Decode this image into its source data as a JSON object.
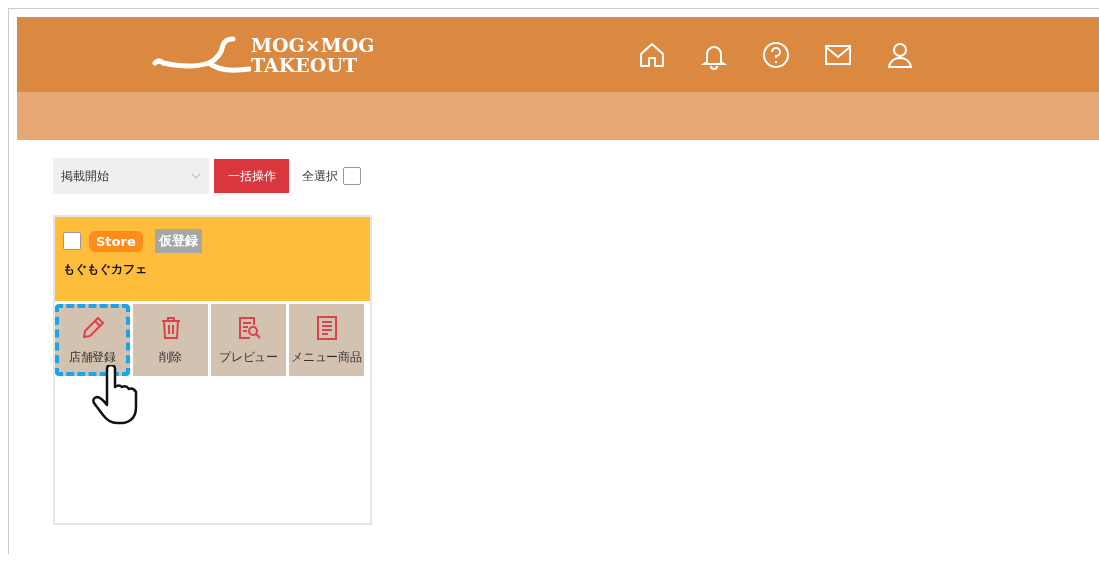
{
  "header": {
    "logo_line_1": "MOG×MOG",
    "logo_line_2": "TAKEOUT"
  },
  "toolbar": {
    "status_select": "掲載開始",
    "bulk_button": "一括操作",
    "select_all": {
      "label": "全選択",
      "checked": false
    }
  },
  "stores": [
    {
      "checked": false,
      "badge": "Store",
      "status": "仮登録",
      "name": "もぐもぐカフェ",
      "actions": [
        {
          "kind": "edit",
          "label": "店舗登録",
          "highlighted": true
        },
        {
          "kind": "delete",
          "label": "削除",
          "highlighted": false
        },
        {
          "kind": "preview",
          "label": "プレビュー",
          "highlighted": false
        },
        {
          "kind": "menu",
          "label": "メニュー商品",
          "highlighted": false
        }
      ]
    }
  ]
}
